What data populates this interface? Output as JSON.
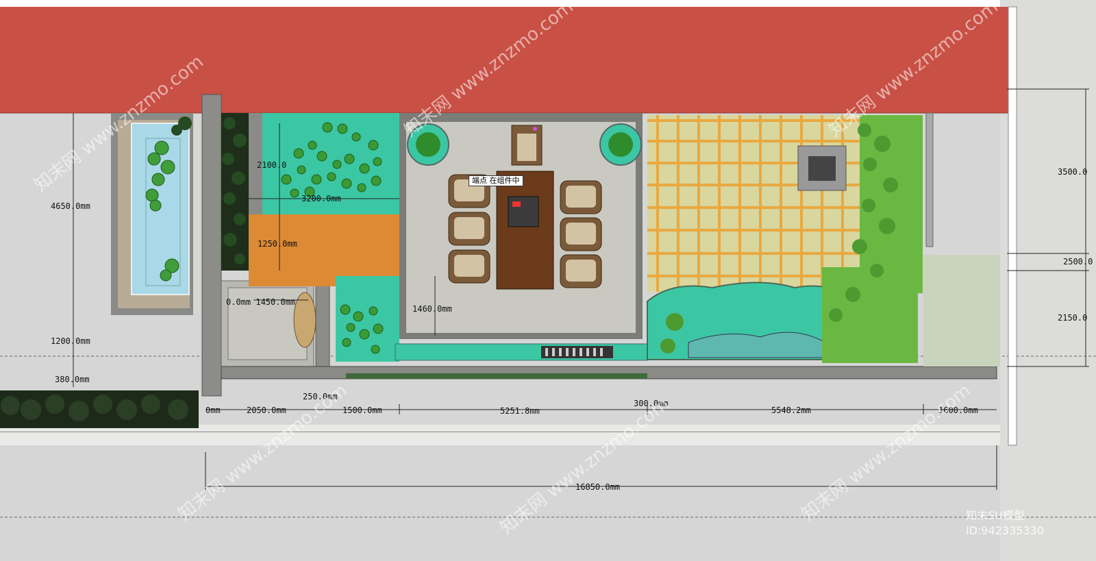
{
  "tooltip": "端点 在组件中",
  "dimensions": {
    "d4650": "4650.0mm",
    "d1200": "1200.0mm",
    "d380": "380.0mm",
    "d2100": "2100.0",
    "d3200": "3200.0mm",
    "d1250": "1250.0mm",
    "d1450": "0.0mm 1450.0mm",
    "d1460": "1460.0mm",
    "d2050": "2050.0mm",
    "d250": "250.0mm",
    "d1500": "1500.0mm",
    "d5251": "5251.8mm",
    "d300": "300.0mm",
    "d5548": "5548.2mm",
    "d1600": "1600.0mm",
    "d16850": "16850.0mm",
    "d3500": "3500.0",
    "d2500": "2500.0",
    "d2150": "2150.0",
    "d0": "0mm"
  },
  "watermark": {
    "text": "知末网 www.znzmo.com",
    "brand": "知末SU模型",
    "id": "ID:942335330"
  },
  "colors": {
    "roof": "#c95045",
    "water": "#3cc7a4",
    "pool": "#a9d8e8",
    "orange": "#dd8a34",
    "grass": "#6ab842",
    "wood": "#6b3b1b",
    "trellis": "#e9a940",
    "floor": "#c9c9c1"
  }
}
